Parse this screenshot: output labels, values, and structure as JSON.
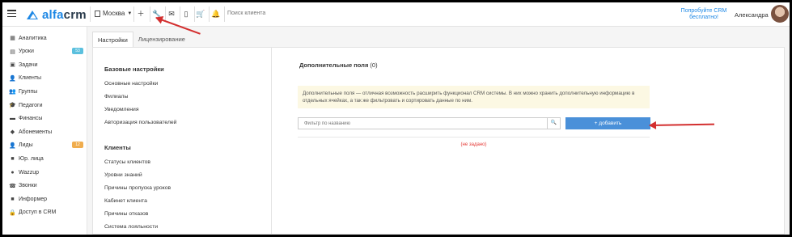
{
  "brand": {
    "name_main": "alfa",
    "name_suffix": "crm"
  },
  "topbar": {
    "branch": "Москва",
    "search_placeholder": "Поиск клиента",
    "promo": "Попробуйте CRM бесплатно!",
    "user_name": "Александра",
    "icons": [
      "plus-icon",
      "wrench-icon",
      "mail-icon",
      "phone-icon",
      "cart-icon",
      "bell-icon"
    ]
  },
  "sidebar": {
    "items": [
      {
        "label": "Аналитика",
        "icon": "chart-icon"
      },
      {
        "label": "Уроки",
        "icon": "calendar-icon",
        "badge": "53",
        "badge_color": "#5bc0de"
      },
      {
        "label": "Задачи",
        "icon": "tasks-icon"
      },
      {
        "label": "Клиенты",
        "icon": "user-icon"
      },
      {
        "label": "Группы",
        "icon": "users-icon"
      },
      {
        "label": "Педагоги",
        "icon": "graduation-cap-icon"
      },
      {
        "label": "Финансы",
        "icon": "money-icon"
      },
      {
        "label": "Абонементы",
        "icon": "tag-icon"
      },
      {
        "label": "Лиды",
        "icon": "user-plus-icon",
        "badge": "12",
        "badge_color": "#f0ad4e"
      },
      {
        "label": "Юр. лица",
        "icon": "briefcase-icon"
      },
      {
        "label": "Wazzup",
        "icon": "whatsapp-icon"
      },
      {
        "label": "Звонки",
        "icon": "phone-icon"
      },
      {
        "label": "Информер",
        "icon": "informer-icon"
      },
      {
        "label": "Доступ в CRM",
        "icon": "lock-icon"
      }
    ]
  },
  "tabs": [
    "Настройки",
    "Лицензирование"
  ],
  "settings_nav": {
    "basic_heading": "Базовые настройки",
    "basic_items": [
      "Основные настройки",
      "Филиалы",
      "Уведомления",
      "Авторизация пользователей"
    ],
    "clients_heading": "Клиенты",
    "clients_items": [
      "Статусы клиентов",
      "Уровни знаний",
      "Причины пропуска уроков",
      "Кабинет клиента",
      "Причины отказов",
      "Система лояльности"
    ]
  },
  "main": {
    "title": "Дополнительные поля",
    "count": "(0)",
    "info": "Дополнительные поля — отличная возможность расширить функционал CRM системы. В них можно хранить дополнительную информацию в отдельных ячейках, а так же фильтровать и сортировать данные по ним.",
    "filter_placeholder": "Фильтр по названию",
    "add_button": "+ добавить",
    "empty_text": "(не задано)"
  },
  "colors": {
    "accent": "#1e88e5",
    "button": "#4a90d9",
    "info_bg": "#fcf8e3",
    "annotation": "#d32f2f",
    "empty": "#e53935"
  }
}
